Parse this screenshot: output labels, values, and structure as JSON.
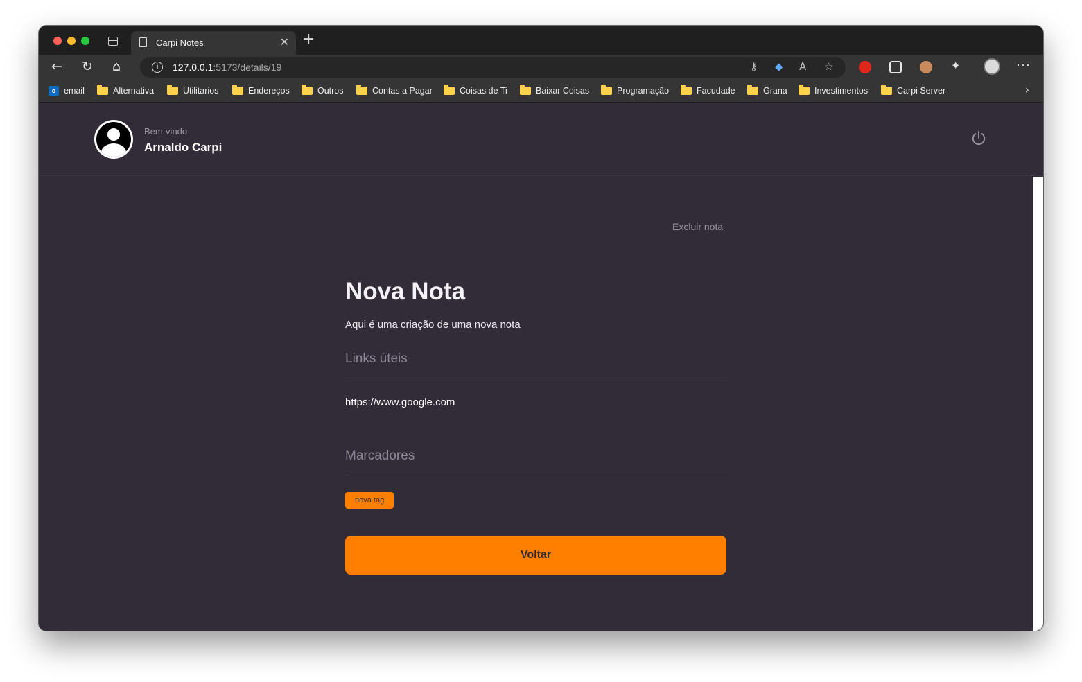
{
  "browser": {
    "tab_title": "Carpi Notes",
    "url_host": "127.0.0.1",
    "url_rest": ":5173/details/19",
    "bookmarks": [
      {
        "label": "email",
        "icon": "outlook-icon"
      },
      {
        "label": "Alternativa",
        "icon": "folder-icon"
      },
      {
        "label": "Utilitarios",
        "icon": "folder-icon"
      },
      {
        "label": "Endereços",
        "icon": "folder-icon"
      },
      {
        "label": "Outros",
        "icon": "folder-icon"
      },
      {
        "label": "Contas a Pagar",
        "icon": "folder-icon"
      },
      {
        "label": "Coisas de Ti",
        "icon": "folder-icon"
      },
      {
        "label": "Baixar Coisas",
        "icon": "folder-icon"
      },
      {
        "label": "Programação",
        "icon": "folder-icon"
      },
      {
        "label": "Facudade",
        "icon": "folder-icon"
      },
      {
        "label": "Grana",
        "icon": "folder-icon"
      },
      {
        "label": "Investimentos",
        "icon": "folder-icon"
      },
      {
        "label": "Carpi Server",
        "icon": "folder-icon"
      }
    ]
  },
  "header": {
    "welcome": "Bem-vindo",
    "username": "Arnaldo Carpi"
  },
  "note": {
    "delete_label": "Excluir nota",
    "title": "Nova Nota",
    "description": "Aqui é uma criação de uma nova nota",
    "links_title": "Links úteis",
    "links": [
      "https://www.google.com"
    ],
    "tags_title": "Marcadores",
    "tags": [
      "nova tag"
    ],
    "back_label": "Voltar"
  },
  "colors": {
    "background": "#312c38",
    "accent": "#ff8000",
    "text_muted": "#9a95a3"
  }
}
